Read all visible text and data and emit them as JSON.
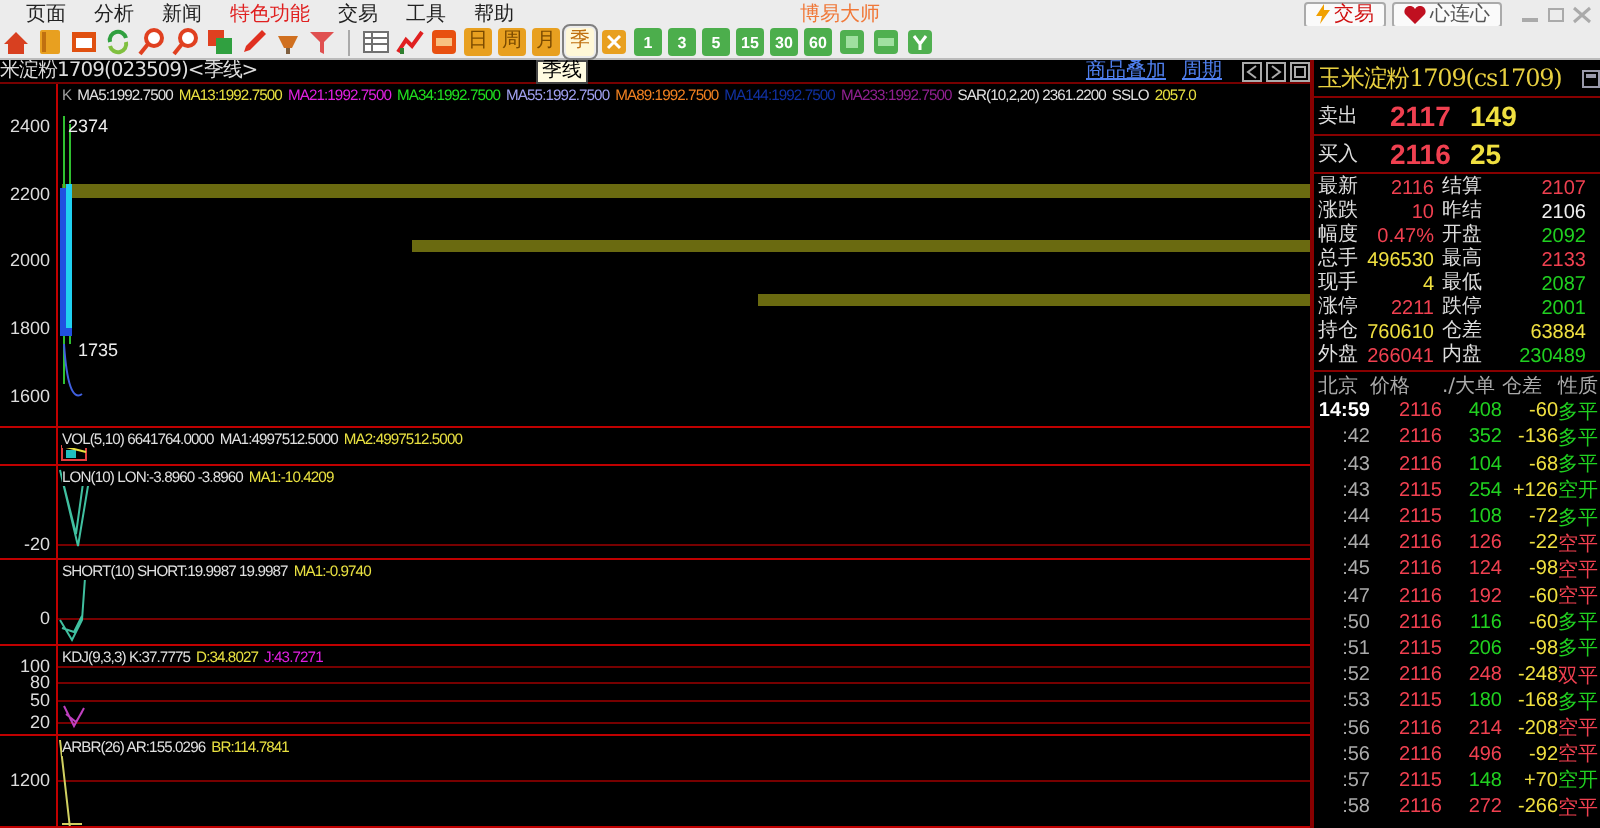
{
  "menu": {
    "items": [
      {
        "label": "页面",
        "highlight": false
      },
      {
        "label": "分析",
        "highlight": false
      },
      {
        "label": "新闻",
        "highlight": false
      },
      {
        "label": "特色功能",
        "highlight": true
      },
      {
        "label": "交易",
        "highlight": false
      },
      {
        "label": "工具",
        "highlight": false
      },
      {
        "label": "帮助",
        "highlight": false
      }
    ],
    "app_title": "博易大师",
    "buttons": [
      {
        "label": "交易",
        "kind": "trade"
      },
      {
        "label": "心连心",
        "kind": "heart"
      }
    ]
  },
  "toolbar": [
    {
      "kind": "icon"
    },
    {
      "kind": "icon"
    },
    {
      "kind": "icon"
    },
    {
      "kind": "icon"
    },
    {
      "kind": "icon"
    },
    {
      "kind": "icon"
    },
    {
      "kind": "icon"
    },
    {
      "kind": "icon"
    },
    {
      "kind": "icon"
    },
    {
      "kind": "icon"
    },
    {
      "kind": "separator"
    },
    {
      "kind": "icon"
    },
    {
      "kind": "icon"
    },
    {
      "kind": "icon"
    },
    {
      "kind": "period",
      "label": "日",
      "selected": false
    },
    {
      "kind": "period",
      "label": "周",
      "selected": false
    },
    {
      "kind": "period",
      "label": "月",
      "selected": false
    },
    {
      "kind": "period",
      "label": "季",
      "selected": true
    },
    {
      "kind": "icon"
    },
    {
      "kind": "minute",
      "label": "1",
      "selected": false
    },
    {
      "kind": "minute",
      "label": "3",
      "selected": false
    },
    {
      "kind": "minute",
      "label": "5",
      "selected": false
    },
    {
      "kind": "minute",
      "label": "15",
      "selected": false
    },
    {
      "kind": "minute",
      "label": "30",
      "selected": false
    },
    {
      "kind": "minute",
      "label": "60",
      "selected": false
    },
    {
      "kind": "icon"
    },
    {
      "kind": "icon"
    },
    {
      "kind": "icon"
    }
  ],
  "chart": {
    "title": "米淀粉1709(023509)<季线>",
    "links": [
      "商品叠加",
      "周期"
    ],
    "tooltip": "季线",
    "panes": [
      {
        "kind": "main",
        "legend": [
          {
            "text": "K",
            "color": "#a0a0a0"
          },
          {
            "text": "MA5:1992.7500",
            "color": "#e0e0e0"
          },
          {
            "text": "MA13:1992.7500",
            "color": "#e8e040"
          },
          {
            "text": "MA21:1992.7500",
            "color": "#e020e0"
          },
          {
            "text": "MA34:1992.7500",
            "color": "#20e020"
          },
          {
            "text": "MA55:1992.7500",
            "color": "#a0a0f0"
          },
          {
            "text": "MA89:1992.7500",
            "color": "#f08020"
          },
          {
            "text": "MA144:1992.7500",
            "color": "#1030a0"
          },
          {
            "text": "MA233:1992.7500",
            "color": "#902090"
          },
          {
            "text": "SAR(10,2,20) 2361.2200",
            "color": "#e0e0e0"
          },
          {
            "text": "SSLO",
            "color": "#e0e0e0"
          },
          {
            "text": "2057.0",
            "color": "#e8e040"
          }
        ],
        "ticks": [
          "2400",
          "2200",
          "2000",
          "1800",
          "1600"
        ],
        "marks": [
          "2374",
          "1735"
        ]
      },
      {
        "kind": "vol",
        "legend": [
          {
            "text": "VOL(5,10) 6641764.0000",
            "color": "#e0e0e0"
          },
          {
            "text": "MA1:4997512.5000",
            "color": "#e0e0e0"
          },
          {
            "text": "MA2:4997512.5000",
            "color": "#e8e040"
          }
        ]
      },
      {
        "kind": "lon",
        "legend": [
          {
            "text": "LON(10) LON:-3.8960 -3.8960",
            "color": "#e0e0e0"
          },
          {
            "text": "MA1:-10.4209",
            "color": "#e8e040"
          }
        ],
        "ticks": [
          "-20"
        ]
      },
      {
        "kind": "short",
        "legend": [
          {
            "text": "SHORT(10) SHORT:19.9987 19.9987",
            "color": "#e0e0e0"
          },
          {
            "text": "MA1:-0.9740",
            "color": "#e8e040"
          }
        ],
        "ticks": [
          "0"
        ]
      },
      {
        "kind": "kdj",
        "legend": [
          {
            "text": "KDJ(9,3,3) K:37.7775",
            "color": "#e0e0e0"
          },
          {
            "text": "D:34.8027",
            "color": "#e8e040"
          },
          {
            "text": "J:43.7271",
            "color": "#e020e0"
          }
        ],
        "ticks": [
          "100",
          "80",
          "50",
          "20"
        ]
      },
      {
        "kind": "arbr",
        "legend": [
          {
            "text": "ARBR(26) AR:155.0296",
            "color": "#e0e0e0"
          },
          {
            "text": "BR:114.7841",
            "color": "#e8e040"
          }
        ],
        "ticks": [
          "1200"
        ]
      }
    ]
  },
  "quote": {
    "title": "玉米淀粉1709(cs1709)",
    "book": [
      {
        "label": "卖出",
        "price": "2117",
        "volume": "149"
      },
      {
        "label": "买入",
        "price": "2116",
        "volume": "25"
      }
    ],
    "stats": [
      {
        "label": "最新",
        "value": "2116",
        "color": "#f04050"
      },
      {
        "label": "结算",
        "value": "2107",
        "color": "#f04050"
      },
      {
        "label": "涨跌",
        "value": "10",
        "color": "#f04050"
      },
      {
        "label": "昨结",
        "value": "2106",
        "color": "#f0f0f0"
      },
      {
        "label": "幅度",
        "value": "0.47%",
        "color": "#f04050"
      },
      {
        "label": "开盘",
        "value": "2092",
        "color": "#20d020"
      },
      {
        "label": "总手",
        "value": "496530",
        "color": "#f0e040"
      },
      {
        "label": "最高",
        "value": "2133",
        "color": "#f04050"
      },
      {
        "label": "现手",
        "value": "4",
        "color": "#f0e040"
      },
      {
        "label": "最低",
        "value": "2087",
        "color": "#20d020"
      },
      {
        "label": "涨停",
        "value": "2211",
        "color": "#f04050"
      },
      {
        "label": "跌停",
        "value": "2001",
        "color": "#20d020"
      },
      {
        "label": "持仓",
        "value": "760610",
        "color": "#f0e040"
      },
      {
        "label": "仓差",
        "value": "63884",
        "color": "#f0e040"
      },
      {
        "label": "外盘",
        "value": "266041",
        "color": "#f04050"
      },
      {
        "label": "内盘",
        "value": "230489",
        "color": "#20d020"
      }
    ],
    "tick_columns": [
      "北京",
      "价格",
      "./大单",
      "仓差",
      "性质"
    ],
    "ticks": [
      {
        "time": "14:59",
        "price": "2116",
        "volume": "408",
        "change": "-60",
        "nature": "多平",
        "color": "#20d020"
      },
      {
        "time": ":42",
        "price": "2116",
        "volume": "352",
        "change": "-136",
        "nature": "多平",
        "color": "#20d020"
      },
      {
        "time": ":43",
        "price": "2116",
        "volume": "104",
        "change": "-68",
        "nature": "多平",
        "color": "#20d020"
      },
      {
        "time": ":43",
        "price": "2115",
        "volume": "254",
        "change": "+126",
        "nature": "空开",
        "color": "#20d020"
      },
      {
        "time": ":44",
        "price": "2115",
        "volume": "108",
        "change": "-72",
        "nature": "多平",
        "color": "#20d020"
      },
      {
        "time": ":44",
        "price": "2116",
        "volume": "126",
        "change": "-22",
        "nature": "空平",
        "color": "#f04050"
      },
      {
        "time": ":45",
        "price": "2116",
        "volume": "124",
        "change": "-98",
        "nature": "空平",
        "color": "#f04050"
      },
      {
        "time": ":47",
        "price": "2116",
        "volume": "192",
        "change": "-60",
        "nature": "空平",
        "color": "#f04050"
      },
      {
        "time": ":50",
        "price": "2116",
        "volume": "116",
        "change": "-60",
        "nature": "多平",
        "color": "#20d020"
      },
      {
        "time": ":51",
        "price": "2115",
        "volume": "206",
        "change": "-98",
        "nature": "多平",
        "color": "#20d020"
      },
      {
        "time": ":52",
        "price": "2116",
        "volume": "248",
        "change": "-248",
        "nature": "双平",
        "color": "#f04050"
      },
      {
        "time": ":53",
        "price": "2115",
        "volume": "180",
        "change": "-168",
        "nature": "多平",
        "color": "#20d020"
      },
      {
        "time": ":56",
        "price": "2116",
        "volume": "214",
        "change": "-208",
        "nature": "空平",
        "color": "#f04050"
      },
      {
        "time": ":56",
        "price": "2116",
        "volume": "496",
        "change": "-92",
        "nature": "空平",
        "color": "#f04050"
      },
      {
        "time": ":57",
        "price": "2115",
        "volume": "148",
        "change": "+70",
        "nature": "空开",
        "color": "#20d020"
      },
      {
        "time": ":58",
        "price": "2116",
        "volume": "272",
        "change": "-266",
        "nature": "空平",
        "color": "#f04050"
      }
    ]
  }
}
